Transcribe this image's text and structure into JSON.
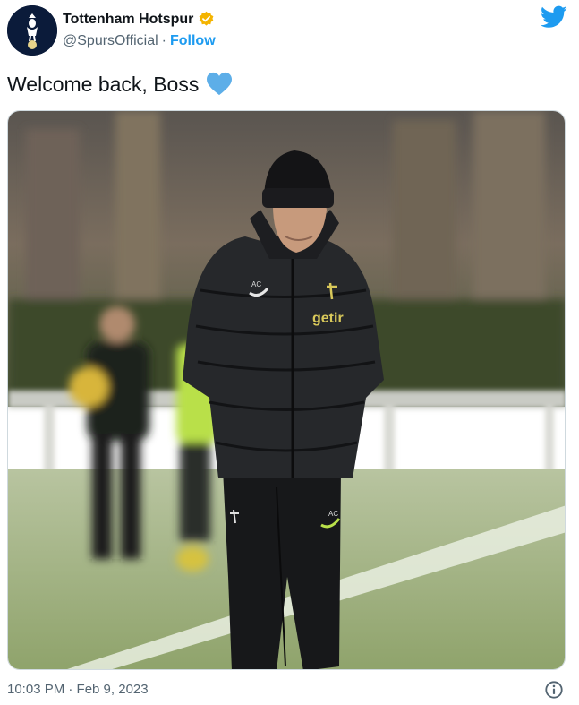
{
  "account": {
    "display_name": "Tottenham Hotspur",
    "handle": "@SpursOfficial",
    "separator": "·",
    "follow_label": "Follow",
    "verified_color": "#f4b400",
    "avatar_icon": "spurs-cockerel-crest-icon"
  },
  "tweet": {
    "text": "Welcome back, Boss",
    "emoji": "blue-heart-icon",
    "timestamp": "10:03 PM · Feb 9, 2023"
  },
  "media": {
    "kit_sponsor": "getir",
    "jacket_initials": "AC",
    "trouser_initials": "AC"
  },
  "icons": {
    "twitter": "twitter-bird-icon",
    "info": "info-icon"
  },
  "colors": {
    "brand_blue": "#1d9bf0",
    "text_primary": "#0f1419",
    "text_secondary": "#536471"
  }
}
